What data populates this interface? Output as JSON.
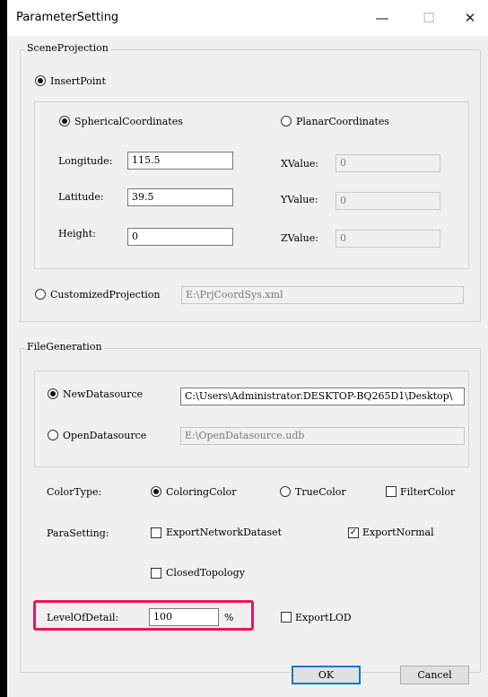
{
  "window": {
    "title": "ParameterSetting",
    "min_icon": "—",
    "max_icon": "☐",
    "close_icon": "✕"
  },
  "scene": {
    "group_label": "SceneProjection",
    "insert_point": {
      "label": "InsertPoint",
      "selected": true
    },
    "spherical": {
      "label": "SphericalCoordinates",
      "selected": true
    },
    "planar": {
      "label": "PlanarCoordinates",
      "selected": false
    },
    "longitude": {
      "label": "Longitude:",
      "value": "115.5"
    },
    "latitude": {
      "label": "Latitude:",
      "value": "39.5"
    },
    "height": {
      "label": "Height:",
      "value": "0"
    },
    "xvalue": {
      "label": "XValue:",
      "value": "0"
    },
    "yvalue": {
      "label": "YValue:",
      "value": "0"
    },
    "zvalue": {
      "label": "ZValue:",
      "value": "0"
    },
    "customized": {
      "label": "CustomizedProjection",
      "value": "E:\\PrjCoordSys.xml",
      "selected": false
    }
  },
  "file": {
    "group_label": "FileGeneration",
    "new_ds": {
      "label": "NewDatasource",
      "value": "C:\\Users\\Administrator.DESKTOP-BQ265D1\\Desktop\\",
      "selected": true
    },
    "open_ds": {
      "label": "OpenDatasource",
      "value": "E:\\OpenDatasource.udb",
      "selected": false
    },
    "color_type": {
      "label": "ColorType:",
      "coloring": {
        "label": "ColoringColor",
        "selected": true
      },
      "true_color": {
        "label": "TrueColor",
        "selected": false
      },
      "filter_color": {
        "label": "FilterColor",
        "checked": false
      }
    },
    "para": {
      "label": "ParaSetting:",
      "export_network": {
        "label": "ExportNetworkDataset",
        "checked": false
      },
      "export_normal": {
        "label": "ExportNormal",
        "checked": true
      },
      "closed_topology": {
        "label": "ClosedTopology",
        "checked": false
      }
    },
    "lod": {
      "label": "LevelOfDetail:",
      "value": "100",
      "unit": "%"
    },
    "export_lod": {
      "label": "ExportLOD",
      "checked": false
    }
  },
  "buttons": {
    "ok": "OK",
    "cancel": "Cancel"
  },
  "colors": {
    "highlight": "#e8175d",
    "default_button_border": "#0078d7"
  }
}
